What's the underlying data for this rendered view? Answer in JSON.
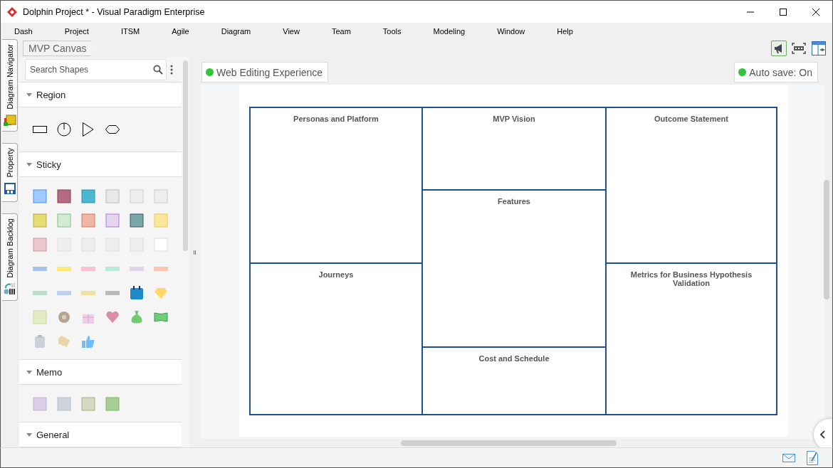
{
  "window": {
    "title": "Dolphin Project * - Visual Paradigm Enterprise"
  },
  "menu": [
    "Dash",
    "Project",
    "ITSM",
    "Agile",
    "Diagram",
    "View",
    "Team",
    "Tools",
    "Modeling",
    "Window",
    "Help"
  ],
  "side_tabs": [
    {
      "label": "Diagram Navigator",
      "kind": "navigator"
    },
    {
      "label": "Property",
      "kind": "property"
    },
    {
      "label": "Diagram Backlog",
      "kind": "backlog"
    }
  ],
  "breadcrumb": "MVP Canvas",
  "palette": {
    "search": {
      "placeholder": "Search Shapes"
    },
    "sections": [
      {
        "title": "Region",
        "kind": "region"
      },
      {
        "title": "Sticky",
        "kind": "sticky"
      },
      {
        "title": "Memo",
        "kind": "memo"
      },
      {
        "title": "General",
        "kind": "general"
      }
    ]
  },
  "canvas": {
    "badges": [
      {
        "label": "Web Editing Experience"
      },
      {
        "label": "Auto save: On"
      }
    ],
    "regions": [
      {
        "title": "Personas and Platform"
      },
      {
        "title": "MVP Vision"
      },
      {
        "title": "Outcome Statement"
      },
      {
        "title": "Features"
      },
      {
        "title": "Journeys"
      },
      {
        "title": "Metrics for Business Hypothesis Validation"
      },
      {
        "title": "Cost and Schedule"
      }
    ]
  }
}
